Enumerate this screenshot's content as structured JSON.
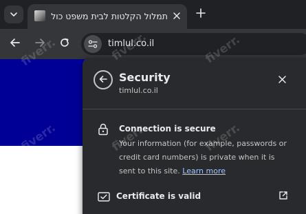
{
  "browser": {
    "tab": {
      "title": "תמלול הקלטות לבית משפט כולל"
    },
    "toolbar": {
      "url": "timlul.co.il"
    }
  },
  "page": {
    "hero_color": "#000096",
    "visible_fragment": ":"
  },
  "security_panel": {
    "title": "Security",
    "domain": "timlul.co.il",
    "connection": {
      "heading": "Connection is secure",
      "body": "Your information (for example, passwords or credit card numbers) is private when it is sent to this site.",
      "learn_more": "Learn more"
    },
    "certificate": {
      "label": "Certificate is valid"
    }
  },
  "watermark": "fiverr."
}
